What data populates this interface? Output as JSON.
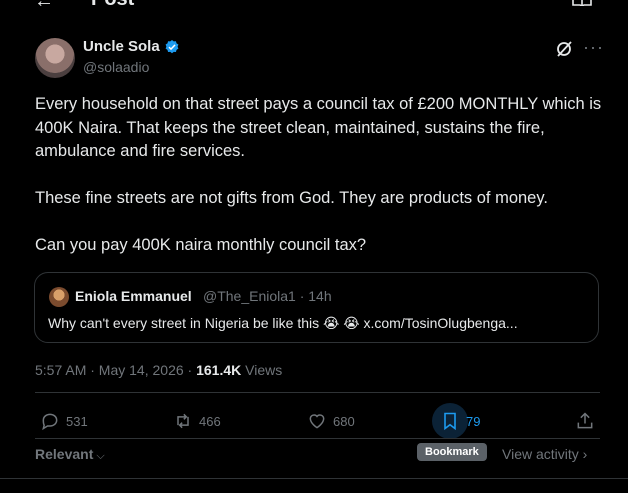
{
  "header": {
    "back_icon": "arrow-left-icon",
    "title": "Post",
    "reader_icon": "reader-icon"
  },
  "post": {
    "author_name": "Uncle Sola",
    "author_handle": "@solaadio",
    "paragraphs": [
      "Every household on that street pays a council tax of £200  MONTHLY which is 400K Naira. That keeps the street clean, maintained, sustains the fire, ambulance and fire services.",
      "These fine streets are not gifts from God. They are products of money.",
      "Can you pay 400K naira  monthly council tax?"
    ],
    "more_label": "···"
  },
  "quote": {
    "name": "Eniola Emmanuel",
    "meta": "@The_Eniola1 · 14h",
    "text": "Why can't every street in Nigeria be like this 😭 😭 x.com/TosinOlugbenga..."
  },
  "meta": {
    "time": "5:57 AM · May 14, 2026 · ",
    "views_count": "161.4K",
    "views_label": " Views"
  },
  "actions": {
    "replies": "531",
    "reposts": "466",
    "likes": "680",
    "bookmarks": "79"
  },
  "footer": {
    "sort_label": "Relevant",
    "tooltip": "Bookmark",
    "activity_label": "View activity"
  },
  "colors": {
    "accent": "#1d9bf0",
    "muted": "#71767b",
    "text": "#e7e9ea",
    "border": "#2f3336"
  }
}
